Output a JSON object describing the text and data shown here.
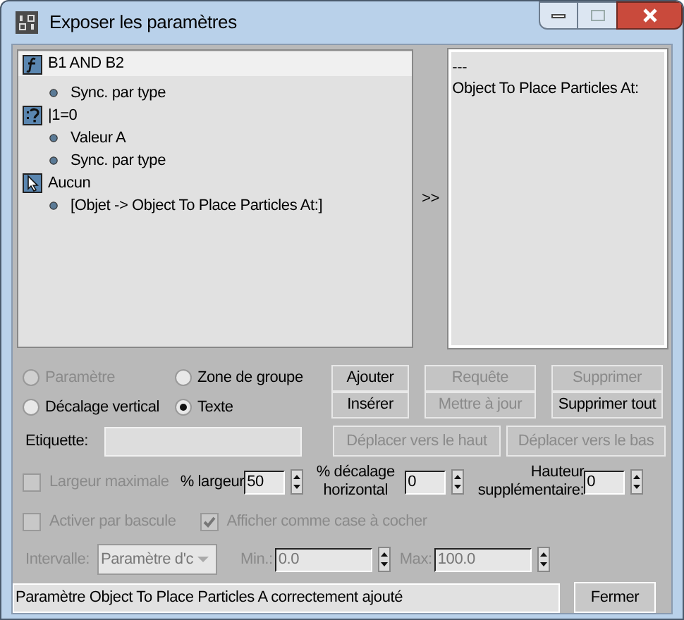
{
  "window": {
    "title": "Exposer les paramètres"
  },
  "tree": [
    {
      "label": "B1 AND B2",
      "kind": "function",
      "selected": true,
      "children": [
        {
          "label": "Sync. par type"
        }
      ]
    },
    {
      "label": "|1=0",
      "kind": "condition",
      "selected": false,
      "children": [
        {
          "label": "Valeur A"
        },
        {
          "label": "Sync. par type"
        }
      ]
    },
    {
      "label": "Aucun",
      "kind": "pointer",
      "selected": false,
      "children": [
        {
          "label": "[Objet -> Object To Place Particles At:]"
        }
      ]
    }
  ],
  "transfer_button": ">>",
  "exposed_list": [
    "---",
    "Object To Place Particles At:"
  ],
  "radios": [
    {
      "label": "Paramètre",
      "selected": false,
      "disabled": true
    },
    {
      "label": "Zone de groupe",
      "selected": false,
      "disabled": false
    },
    {
      "label": "Décalage vertical",
      "selected": false,
      "disabled": false
    },
    {
      "label": "Texte",
      "selected": true,
      "disabled": false
    }
  ],
  "buttons_row1": [
    {
      "label": "Ajouter",
      "disabled": false
    },
    {
      "label": "Requête",
      "disabled": true
    },
    {
      "label": "Supprimer",
      "disabled": true
    }
  ],
  "buttons_row2": [
    {
      "label": "Insérer",
      "disabled": false
    },
    {
      "label": "Mettre à jour",
      "disabled": true
    },
    {
      "label": "Supprimer tout",
      "disabled": false
    }
  ],
  "label_field": {
    "label": "Etiquette:",
    "disabled": true
  },
  "move_buttons": [
    {
      "label": "Déplacer vers le haut",
      "disabled": true
    },
    {
      "label": "Déplacer vers le bas",
      "disabled": true
    }
  ],
  "max_width": {
    "label": "Largeur maximale",
    "checked": false,
    "disabled": true
  },
  "width_percent": {
    "label": "% largeur",
    "value": "50"
  },
  "h_offset": {
    "label": "% décalage horizontal",
    "value": "0"
  },
  "extra_height": {
    "label": "Hauteur supplémentaire:",
    "value": "0"
  },
  "toggle_enable": {
    "label": "Activer par bascule",
    "checked": false,
    "disabled": true
  },
  "show_checkbox": {
    "label": "Afficher comme case à cocher",
    "checked": true,
    "disabled": true
  },
  "range": {
    "label": "Intervalle:",
    "dropdown": "Paramètre d'c",
    "min_label": "Min.:",
    "min": "0.0",
    "max_label": "Max:",
    "max": "100.0",
    "disabled": true
  },
  "status": "Paramètre Object To Place Particles A correctement ajouté",
  "close_button": "Fermer"
}
